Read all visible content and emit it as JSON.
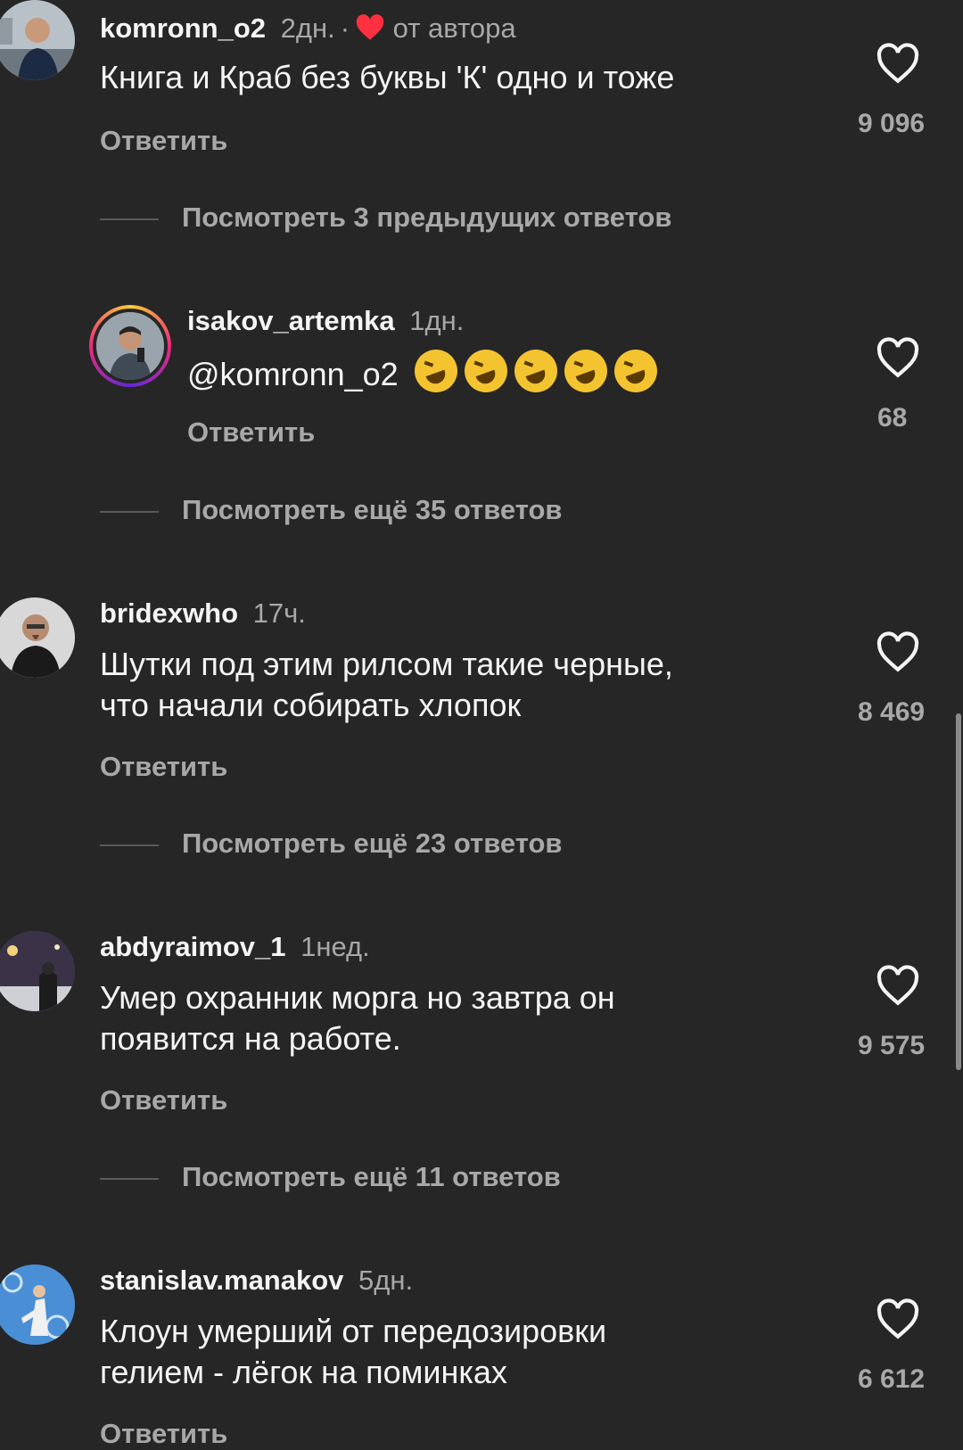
{
  "comments": [
    {
      "user": "komronn_o2",
      "time": "2дн.",
      "author_badge": "от автора",
      "text": [
        "Книга и Краб без буквы 'К' одно и тоже"
      ],
      "reply": "Ответить",
      "likes": "9 096",
      "more": "Посмотреть 3 предыдущих ответов"
    },
    {
      "user": "isakov_artemka",
      "time": "1дн.",
      "text": [
        "@komronn_o2"
      ],
      "emojis": [
        "rofl-emoji",
        "rofl-emoji",
        "rofl-emoji",
        "rofl-emoji",
        "rofl-emoji"
      ],
      "reply": "Ответить",
      "likes": "68",
      "more": "Посмотреть ещё 35 ответов"
    },
    {
      "user": "bridexwho",
      "time": "17ч.",
      "text": [
        "Шутки под этим рилсом такие черные,",
        "что начали собирать хлопок"
      ],
      "reply": "Ответить",
      "likes": "8 469",
      "more": "Посмотреть ещё 23 ответов"
    },
    {
      "user": "abdyraimov_1",
      "time": "1нед.",
      "text": [
        "Умер охранник морга но завтра он",
        "появится на работе."
      ],
      "reply": "Ответить",
      "likes": "9 575",
      "more": "Посмотреть ещё 11 ответов"
    },
    {
      "user": "stanislav.manakov",
      "time": "5дн.",
      "text": [
        "Клоун умерший от передозировки",
        "гелием - лёгок на поминках"
      ],
      "reply": "Ответить",
      "likes": "6 612"
    }
  ],
  "colors": {
    "background": "#262626",
    "secondary_text": "#a8a8a8",
    "heart_badge": "#ff3040"
  }
}
